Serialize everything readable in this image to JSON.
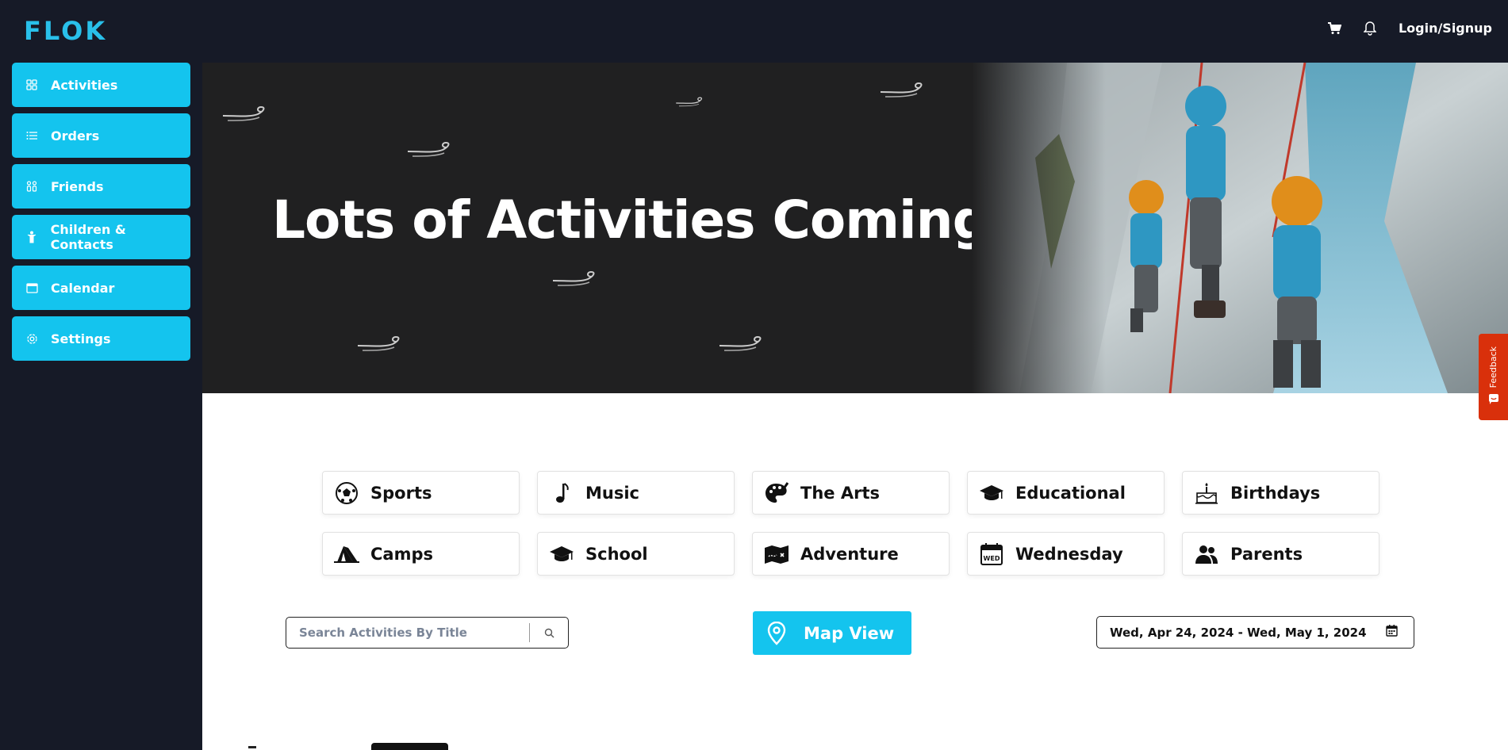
{
  "app": {
    "logo": "FLOK"
  },
  "topbar": {
    "cart_icon": "cart-icon",
    "bell_icon": "bell-icon",
    "login_label": "Login/Signup"
  },
  "sidebar": {
    "items": [
      {
        "label": "Activities",
        "icon": "grid-icon"
      },
      {
        "label": "Orders",
        "icon": "list-icon"
      },
      {
        "label": "Friends",
        "icon": "friends-icon"
      },
      {
        "label": "Children & Contacts",
        "icon": "child-icon"
      },
      {
        "label": "Calendar",
        "icon": "calendar-icon"
      },
      {
        "label": "Settings",
        "icon": "gear-icon"
      }
    ]
  },
  "hero": {
    "title": "Lots of Activities Coming Soon"
  },
  "categories": [
    {
      "label": "Sports",
      "icon": "soccer-ball-icon"
    },
    {
      "label": "Music",
      "icon": "music-note-icon"
    },
    {
      "label": "The Arts",
      "icon": "palette-icon"
    },
    {
      "label": "Educational",
      "icon": "graduation-cap-icon"
    },
    {
      "label": "Birthdays",
      "icon": "birthday-cake-icon"
    },
    {
      "label": "Camps",
      "icon": "tent-icon"
    },
    {
      "label": "School",
      "icon": "school-cap-icon"
    },
    {
      "label": "Adventure",
      "icon": "map-icon"
    },
    {
      "label": "Wednesday",
      "icon": "calendar-wed-icon"
    },
    {
      "label": "Parents",
      "icon": "parents-icon"
    }
  ],
  "search": {
    "placeholder": "Search Activities By Title"
  },
  "map_button": {
    "label": "Map View"
  },
  "date_range": {
    "value": "Wed, Apr 24, 2024 - Wed, May 1, 2024"
  },
  "feedback": {
    "label": "Feedback"
  },
  "colors": {
    "accent": "#14c4ee",
    "sidebar_bg": "#161a27",
    "hero_bg": "#202021",
    "feedback": "#d9300b"
  }
}
